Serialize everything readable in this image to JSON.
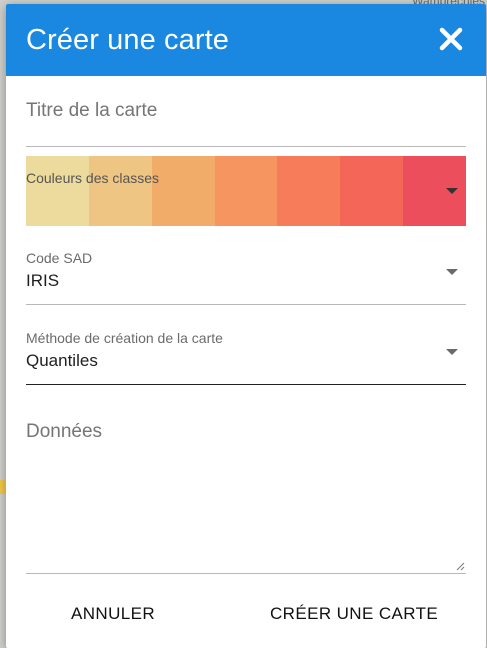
{
  "background": {
    "map_label": "Wambrechies"
  },
  "dialog": {
    "title": "Créer une carte",
    "close_icon": "close-icon",
    "header_color": "#1a88e0"
  },
  "form": {
    "title_field": {
      "placeholder": "Titre de la carte",
      "value": ""
    },
    "palette": {
      "label": "Couleurs des classes",
      "colors": [
        "#ecdb9c",
        "#efc583",
        "#f2ac6a",
        "#f6955f",
        "#f77d5a",
        "#f36658",
        "#ec4e5c"
      ]
    },
    "code_sad": {
      "label": "Code SAD",
      "value": "IRIS"
    },
    "method": {
      "label": "Méthode de création de la carte",
      "value": "Quantiles"
    },
    "data_field": {
      "placeholder": "Données",
      "value": ""
    }
  },
  "actions": {
    "cancel_label": "ANNULER",
    "create_label": "CRÉER UNE CARTE"
  }
}
